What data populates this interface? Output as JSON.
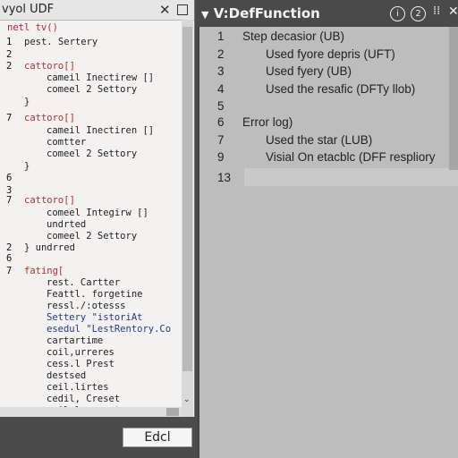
{
  "left_window": {
    "title": "vyol UDF",
    "close_glyph": "✕",
    "lines": [
      {
        "n": "",
        "t": "netl tv()",
        "cls": "red"
      },
      {
        "n": "1",
        "t": "pest. Sertery",
        "cls": ""
      },
      {
        "n": "2",
        "t": "",
        "cls": ""
      },
      {
        "n": "2",
        "t": "cattoro[]",
        "cls": "kw"
      },
      {
        "n": "",
        "t": "cameil Inectirew []",
        "cls": ""
      },
      {
        "n": "",
        "t": "comeel 2 Settory",
        "cls": ""
      },
      {
        "n": "",
        "t": "}",
        "cls": ""
      },
      {
        "n": "",
        "t": "",
        "cls": ""
      },
      {
        "n": "7",
        "t": "cattoro[]",
        "cls": "kw"
      },
      {
        "n": "",
        "t": "cameil Inectiren []",
        "cls": ""
      },
      {
        "n": "",
        "t": "comtter",
        "cls": ""
      },
      {
        "n": "",
        "t": "comeel 2 Settory",
        "cls": ""
      },
      {
        "n": "",
        "t": "}",
        "cls": ""
      },
      {
        "n": "6",
        "t": "",
        "cls": ""
      },
      {
        "n": "3",
        "t": "",
        "cls": ""
      },
      {
        "n": "7",
        "t": "cattoro[]",
        "cls": "kw"
      },
      {
        "n": "",
        "t": "comeel Integirw []",
        "cls": ""
      },
      {
        "n": "",
        "t": "undrted",
        "cls": ""
      },
      {
        "n": "",
        "t": "comeel 2 Settory",
        "cls": ""
      },
      {
        "n": "2",
        "t": "}  undrred",
        "cls": ""
      },
      {
        "n": "6",
        "t": "",
        "cls": ""
      },
      {
        "n": "7",
        "t": "fating[",
        "cls": "kw"
      },
      {
        "n": "",
        "t": "rest. Cartter",
        "cls": ""
      },
      {
        "n": "",
        "t": "Feattl. forgetine",
        "cls": ""
      },
      {
        "n": "",
        "t": "ressl./:otesss",
        "cls": ""
      },
      {
        "n": "",
        "t": "Settery \"istoriAt",
        "cls": "blue"
      },
      {
        "n": "",
        "t": "esedul \"LestRentory.Co",
        "cls": "blue"
      },
      {
        "n": "",
        "t": "cartartime",
        "cls": ""
      },
      {
        "n": "",
        "t": "coil,urreres",
        "cls": ""
      },
      {
        "n": "",
        "t": "cess.l Prest",
        "cls": ""
      },
      {
        "n": "",
        "t": "destsed",
        "cls": ""
      },
      {
        "n": "",
        "t": "ceil.lirtes",
        "cls": ""
      },
      {
        "n": "",
        "t": "cedil, Creset",
        "cls": ""
      },
      {
        "n": "",
        "t": "ceil.lrerreat",
        "cls": ""
      }
    ]
  },
  "edit_button": {
    "label": "Edcl"
  },
  "right_window": {
    "title": "V:DefFunction",
    "controls": [
      "i",
      "2"
    ],
    "dots": "⁞⁞",
    "close_glyph": "✕",
    "lines": [
      {
        "n": "1",
        "t": "Step decasior (UB)",
        "indent": false
      },
      {
        "n": "2",
        "t": "Used fyore depris (UFT)",
        "indent": true
      },
      {
        "n": "3",
        "t": "Used fyery (UB)",
        "indent": true
      },
      {
        "n": "4",
        "t": "Used the resafic (DFTy llob)",
        "indent": true
      },
      {
        "n": "5",
        "t": "",
        "indent": false
      },
      {
        "n": "6",
        "t": "Error log)",
        "indent": false
      },
      {
        "n": "7",
        "t": "Used the star (LUB)",
        "indent": true
      },
      {
        "n": "9",
        "t": "Visial On etacblc (DFF respliory",
        "indent": true
      },
      {
        "n": "13",
        "t": "",
        "indent": false
      }
    ]
  }
}
